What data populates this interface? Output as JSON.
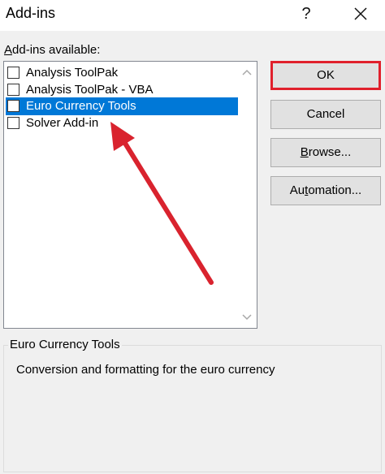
{
  "window": {
    "title": "Add-ins",
    "help_glyph": "?"
  },
  "addins": {
    "label_prefix": "A",
    "label_rest": "dd-ins available:",
    "items": [
      {
        "label": "Analysis ToolPak",
        "checked": false,
        "selected": false
      },
      {
        "label": "Analysis ToolPak - VBA",
        "checked": false,
        "selected": false
      },
      {
        "label": "Euro Currency Tools",
        "checked": false,
        "selected": true
      },
      {
        "label": "Solver Add-in",
        "checked": false,
        "selected": false
      }
    ]
  },
  "buttons": {
    "ok": "OK",
    "cancel": "Cancel",
    "browse_prefix": "B",
    "browse_rest": "rowse...",
    "automation_prefix": "Au",
    "automation_u": "t",
    "automation_rest": "omation..."
  },
  "description": {
    "title": "Euro Currency Tools",
    "text": "Conversion and formatting for the euro currency"
  },
  "colors": {
    "selection": "#0078d7",
    "highlight_border": "#e0202c",
    "annotation_arrow": "#d9232e"
  },
  "icons": [
    "question-mark-icon",
    "close-icon",
    "scroll-up-icon",
    "scroll-down-icon"
  ]
}
